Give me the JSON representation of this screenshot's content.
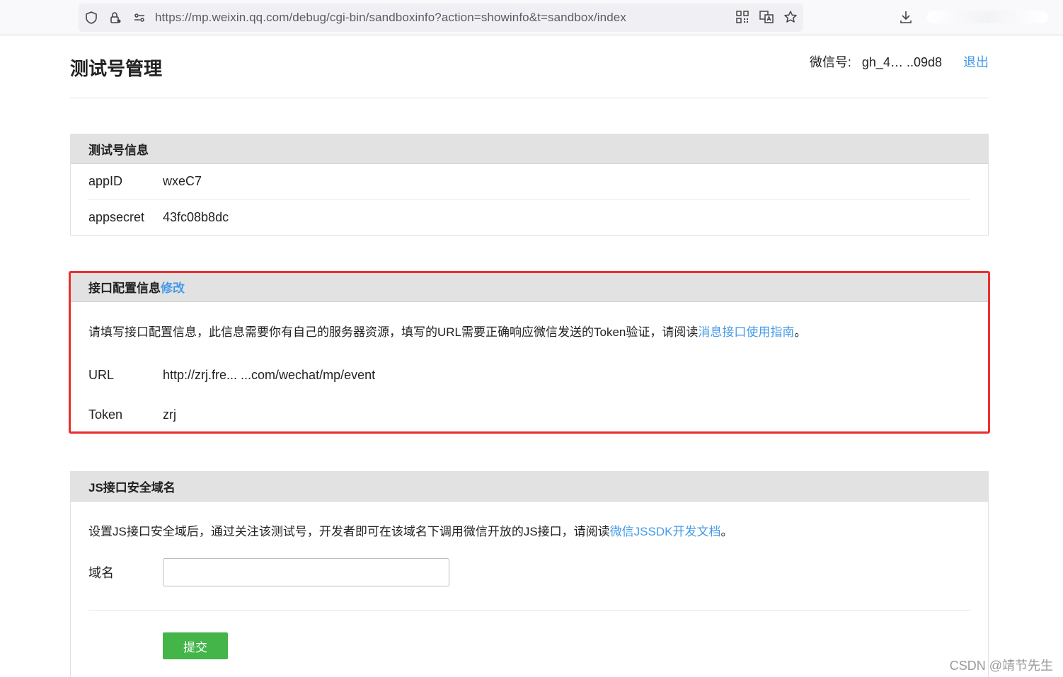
{
  "browser": {
    "url": "https://mp.weixin.qq.com/debug/cgi-bin/sandboxinfo?action=showinfo&t=sandbox/index"
  },
  "header": {
    "title": "测试号管理",
    "account_label": "微信号:",
    "account_value": "gh_4…  ..09d8",
    "logout": "退出"
  },
  "test_account": {
    "title": "测试号信息",
    "rows": [
      {
        "key": "appID",
        "value": "wxeC7"
      },
      {
        "key": "appsecret",
        "value": "43fc08b8dc"
      }
    ]
  },
  "interface": {
    "title": "接口配置信息",
    "edit": "修改",
    "desc_prefix": "请填写接口配置信息，此信息需要你有自己的服务器资源，填写的URL需要正确响应微信发送的Token验证，请阅读",
    "desc_link": "消息接口使用指南",
    "desc_suffix": "。",
    "rows": [
      {
        "key": "URL",
        "value": "http://zrj.fre...      ...com/wechat/mp/event"
      },
      {
        "key": "Token",
        "value": "zrj"
      }
    ]
  },
  "js_domain": {
    "title": "JS接口安全域名",
    "desc_prefix": "设置JS接口安全域后，通过关注该测试号，开发者即可在该域名下调用微信开放的JS接口，请阅读",
    "desc_link": "微信JSSDK开发文档",
    "desc_suffix": "。",
    "field_label": "域名",
    "field_value": "",
    "submit": "提交"
  },
  "watermark": "CSDN @靖节先生"
}
